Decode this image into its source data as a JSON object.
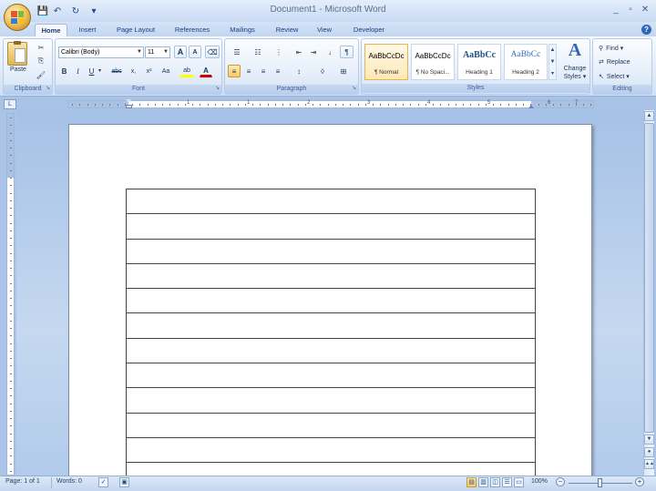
{
  "window": {
    "title": "Document1 - Microsoft Word",
    "minimize": "_",
    "restore": "▫",
    "close": "✕"
  },
  "qat": {
    "save": "💾",
    "undo": "↶",
    "redo": "↻",
    "customize": "▾"
  },
  "tabs": [
    "Home",
    "Insert",
    "Page Layout",
    "References",
    "Mailings",
    "Review",
    "View",
    "Developer"
  ],
  "help": "?",
  "ribbon": {
    "clipboard": {
      "label": "Clipboard",
      "paste": "Paste",
      "cut": "✂",
      "copy": "⎘",
      "format_painter": "🖌"
    },
    "font": {
      "label": "Font",
      "font_name": "Calibri (Body)",
      "font_size": "11",
      "grow": "A",
      "shrink": "A",
      "clear": "⌫",
      "bold": "B",
      "italic": "I",
      "underline": "U",
      "strike": "abc",
      "subscript": "x,",
      "superscript": "x²",
      "change_case": "Aa",
      "highlight": "ab",
      "font_color": "A"
    },
    "paragraph": {
      "label": "Paragraph",
      "bullets": "☰",
      "numbering": "☷",
      "multilevel": "⋮",
      "decrease_indent": "⇤",
      "increase_indent": "⇥",
      "sort": "↓",
      "show_marks": "¶",
      "align_left": "≡",
      "center": "≡",
      "align_right": "≡",
      "justify": "≡",
      "line_spacing": "↕",
      "shading": "◊",
      "borders": "⊞"
    },
    "styles": {
      "label": "Styles",
      "items": [
        {
          "sample": "AaBbCcDc",
          "name": "¶ Normal"
        },
        {
          "sample": "AaBbCcDc",
          "name": "¶ No Spaci..."
        },
        {
          "sample": "AaBbCc",
          "name": "Heading 1"
        },
        {
          "sample": "AaBbCc",
          "name": "Heading 2"
        }
      ],
      "change_styles_line1": "Change",
      "change_styles_line2": "Styles ▾"
    },
    "editing": {
      "label": "Editing",
      "find": "Find ▾",
      "replace": "Replace",
      "select": "Select ▾"
    }
  },
  "ruler": {
    "corner": "L",
    "numbers": [
      "1",
      "1",
      "2",
      "3",
      "4",
      "5",
      "6",
      "7"
    ]
  },
  "document": {
    "table_rows": 12
  },
  "status": {
    "page": "Page: 1 of 1",
    "words": "Words: 0",
    "zoom": "100%",
    "zoom_out": "−",
    "zoom_in": "+"
  },
  "colors": {
    "ribbon_blue": "#15428b",
    "highlight_yellow": "#ffff00",
    "font_red": "#d00000",
    "style_active": "#ffe9b5"
  }
}
